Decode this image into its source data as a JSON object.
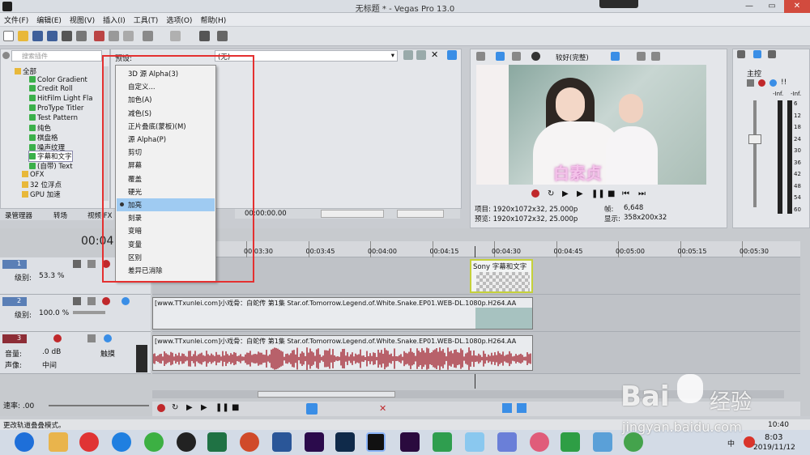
{
  "window": {
    "title": "无标题 * - Vegas Pro 13.0",
    "controls": [
      "—",
      "▭",
      "✕"
    ]
  },
  "menubar": [
    "文件(F)",
    "编辑(E)",
    "视图(V)",
    "插入(I)",
    "工具(T)",
    "选项(O)",
    "帮助(H)"
  ],
  "explorer": {
    "search_placeholder": "搜索插件",
    "items": [
      {
        "label": "全部",
        "type": "folder",
        "indent": 0
      },
      {
        "label": "Color Gradient",
        "type": "fx",
        "indent": 2
      },
      {
        "label": "Credit Roll",
        "type": "fx",
        "indent": 2
      },
      {
        "label": "HitFilm Light Fla",
        "type": "fx",
        "indent": 2
      },
      {
        "label": "ProType Titler",
        "type": "fx",
        "indent": 2
      },
      {
        "label": "Test Pattern",
        "type": "fx",
        "indent": 2
      },
      {
        "label": "纯色",
        "type": "fx",
        "indent": 2
      },
      {
        "label": "棋盘格",
        "type": "fx",
        "indent": 2
      },
      {
        "label": "噪声纹理",
        "type": "fx",
        "indent": 2
      },
      {
        "label": "字幕和文字",
        "type": "fx",
        "indent": 2,
        "selected": true
      },
      {
        "label": "(自带) Text",
        "type": "fx",
        "indent": 2
      },
      {
        "label": "OFX",
        "type": "folder",
        "indent": 1
      },
      {
        "label": "32 位浮点",
        "type": "folder",
        "indent": 1
      },
      {
        "label": "GPU 加速",
        "type": "folder",
        "indent": 1
      }
    ]
  },
  "tabs": [
    "录管理器",
    "转场",
    "视频 FX"
  ],
  "preset": {
    "label": "预设:",
    "combo_value": "(无)"
  },
  "compositing_menu": {
    "items": [
      {
        "label": "3D 源 Alpha(3)",
        "selected": false
      },
      {
        "label": "自定义...",
        "selected": false
      },
      {
        "label": "加色(A)",
        "selected": false
      },
      {
        "label": "减色(S)",
        "selected": false
      },
      {
        "label": "正片叠底(蒙板)(M)",
        "selected": false
      },
      {
        "label": "源 Alpha(P)",
        "selected": false
      },
      {
        "label": "剪切",
        "selected": false
      },
      {
        "label": "屏幕",
        "selected": false
      },
      {
        "label": "覆盖",
        "selected": false
      },
      {
        "label": "硬光",
        "selected": false
      },
      {
        "label": "加亮",
        "selected": true
      },
      {
        "label": "刻录",
        "selected": false
      },
      {
        "label": "变暗",
        "selected": false
      },
      {
        "label": "变量",
        "selected": false
      },
      {
        "label": "区别",
        "selected": false
      },
      {
        "label": "差异已消除",
        "selected": false
      }
    ]
  },
  "preview": {
    "quality": "较好(完整)",
    "video_caption": "白素贞",
    "info": {
      "project": "项目: 1920x1072x32, 25.000p",
      "preview": "预览: 1920x1072x32, 25.000p",
      "frame": "帧:",
      "frame_value": "6,648",
      "display": "显示:",
      "display_value": "358x200x32"
    }
  },
  "trimmer": {
    "timecode": "00:00:00.00"
  },
  "master": {
    "label": "主控",
    "scale": [
      "-Inf.",
      "-Inf."
    ],
    "db": [
      "6",
      "12",
      "18",
      "24",
      "30",
      "36",
      "42",
      "48",
      "54",
      "60"
    ]
  },
  "timeline": {
    "time": "00:04",
    "ruler": [
      "00:03:30",
      "00:03:45",
      "00:04:00",
      "00:04:15",
      "00:04:30",
      "00:04:45",
      "00:05:00",
      "00:05:15",
      "00:05:30"
    ],
    "tracks": [
      {
        "num": "1",
        "level_label": "级别:",
        "level": "53.3 %"
      },
      {
        "num": "2",
        "level_label": "级别:",
        "level": "100.0 %"
      },
      {
        "num": "3",
        "vol_label": "音量:",
        "vol": ".0 dB",
        "pan_label": "声像:",
        "pan": "中间",
        "mode": "触摸"
      }
    ],
    "clips": {
      "text_clip": "Sony 字幕和文字",
      "video_clip": "[www.TTxunlei.com]小戏骨：白蛇传 第1集 Star.of.Tomorrow.Legend.of.White.Snake.EP01.WEB-DL.1080p.H264.AA",
      "audio_clip": "[www.TTxunlei.com]小戏骨：白蛇传 第1集 Star.of.Tomorrow.Legend.of.White.Snake.EP01.WEB-DL.1080p.H264.AA"
    },
    "rate": "速率: .00"
  },
  "status": "更改轨道叠叠模式。",
  "taskbar": {
    "clock": "8:03",
    "date": "2019/11/12",
    "tray_lang": "中",
    "extra_time": "10:40"
  },
  "watermark": {
    "brand": "Bai",
    "brand2": "经验",
    "url": "jingyan.baidu.com"
  },
  "colors": {
    "accent": "#3a8ee6",
    "redbox": "#e43030",
    "selection": "#9fcbf2",
    "waveform": "#a8333f"
  }
}
